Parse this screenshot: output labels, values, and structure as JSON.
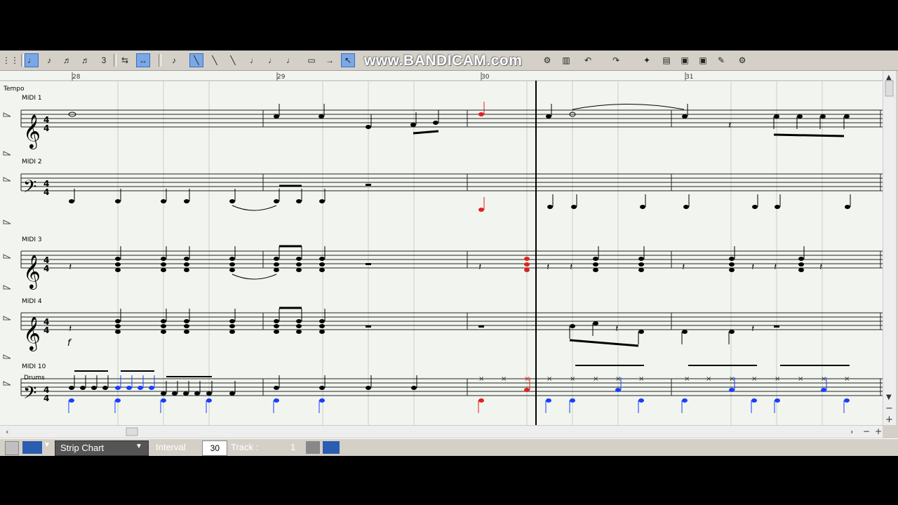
{
  "toolbar": {
    "watermark": "www.BANDICAM.com",
    "buttons": [
      "step-icon",
      "quarter-note-icon",
      "eighth-note-icon",
      "sixteenth-note-icon",
      "thirtysecond-note-icon",
      "triplet-icon",
      "rest-icon",
      "stretch-icon",
      "dot-icon",
      "pen-icon",
      "line-icon",
      "curve-icon",
      "beam-icon",
      "tie-icon",
      "slur-icon",
      "box-icon",
      "arrow-right-icon",
      "select-arrow-icon",
      "undo-icon",
      "redo-icon",
      "settings-icon"
    ]
  },
  "ruler": {
    "measures": [
      "28",
      "29",
      "30",
      "31"
    ]
  },
  "tracks": {
    "tempo": "Tempo",
    "t1": "MIDI 1",
    "t2": "MIDI 2",
    "t3": "MIDI 3",
    "t4": "MIDI 4",
    "t10": "MIDI 10",
    "t10_sub": "Drums"
  },
  "status": {
    "view_mode": "Strip Chart",
    "interval_label": "Interval",
    "interval_value": "30",
    "track_label": "Track  :",
    "track_value": "1"
  },
  "colors": {
    "accent_red": "#e02020",
    "drum_blue": "#1a3cff",
    "bg": "#f2f5ef"
  }
}
